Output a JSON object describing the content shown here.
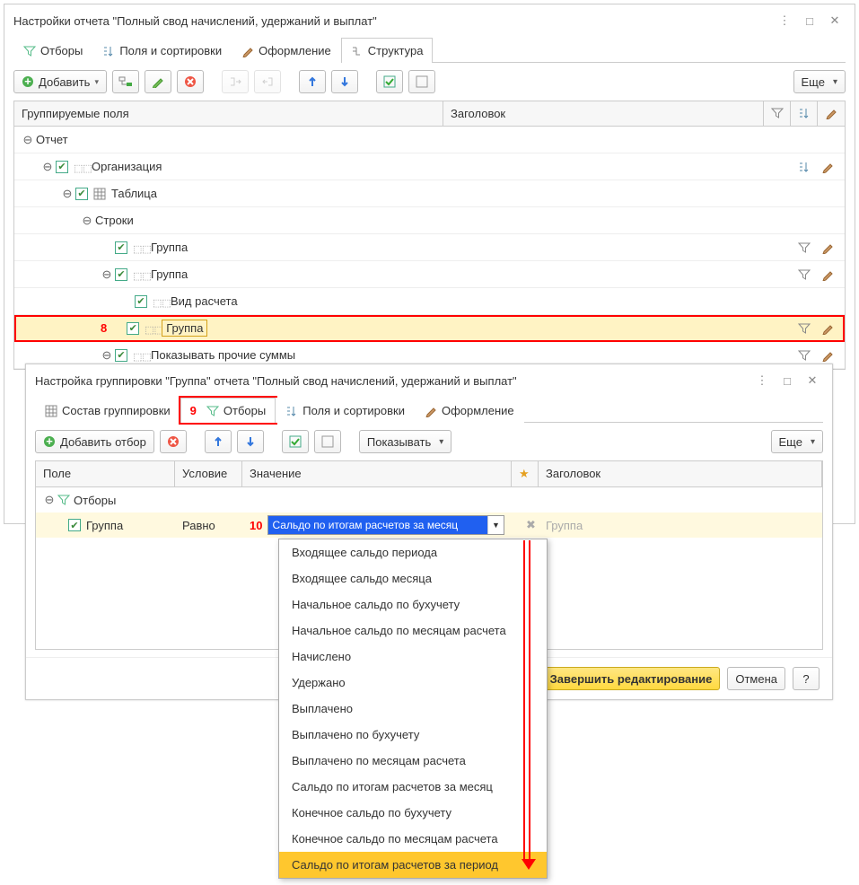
{
  "main": {
    "title": "Настройки отчета \"Полный свод начислений, удержаний и выплат\"",
    "tabs": [
      "Отборы",
      "Поля и сортировки",
      "Оформление",
      "Структура"
    ],
    "active_tab": 3,
    "toolbar": {
      "add": "Добавить",
      "more": "Еще"
    },
    "columns": {
      "group_fields": "Группируемые поля",
      "header": "Заголовок"
    },
    "annotation8": "8",
    "tree": [
      {
        "indent": 0,
        "exp": true,
        "check": false,
        "icon": "",
        "label": "Отчет"
      },
      {
        "indent": 1,
        "exp": true,
        "check": true,
        "icon": "link",
        "label": "Организация"
      },
      {
        "indent": 2,
        "exp": true,
        "check": true,
        "icon": "table",
        "label": "Таблица"
      },
      {
        "indent": 3,
        "exp": true,
        "check": false,
        "icon": "",
        "label": "Строки"
      },
      {
        "indent": 4,
        "exp": false,
        "check": true,
        "icon": "link",
        "label": "Группа"
      },
      {
        "indent": 4,
        "exp": true,
        "check": true,
        "icon": "link",
        "label": "Группа"
      },
      {
        "indent": 5,
        "exp": false,
        "check": true,
        "icon": "link",
        "label": "Вид расчета"
      },
      {
        "indent": 4,
        "exp": false,
        "check": true,
        "icon": "link",
        "label": "Группа",
        "boxed": true
      },
      {
        "indent": 4,
        "exp": true,
        "check": true,
        "icon": "link",
        "label": "Показывать прочие суммы"
      }
    ]
  },
  "sub": {
    "title": "Настройка группировки \"Группа\" отчета \"Полный свод начислений, удержаний и выплат\"",
    "tabs": [
      "Состав группировки",
      "Отборы",
      "Поля и сортировки",
      "Оформление"
    ],
    "active_tab": 1,
    "annotation9": "9",
    "toolbar": {
      "add": "Добавить отбор",
      "show": "Показывать",
      "more": "Еще"
    },
    "cols": {
      "field": "Поле",
      "cond": "Условие",
      "value": "Значение",
      "star": "★",
      "header": "Заголовок"
    },
    "root": "Отборы",
    "annotation10": "10",
    "row": {
      "field": "Группа",
      "cond": "Равно",
      "value": "Сальдо по итогам расчетов за месяц",
      "header_hint": "Группа"
    },
    "dropdown": [
      "Входящее сальдо периода",
      "Входящее сальдо месяца",
      "Начальное сальдо по бухучету",
      "Начальное сальдо по месяцам расчета",
      "Начислено",
      "Удержано",
      "Выплачено",
      "Выплачено по бухучету",
      "Выплачено по месяцам расчета",
      "Сальдо по итогам расчетов за месяц",
      "Конечное сальдо по бухучету",
      "Конечное сальдо по месяцам расчета",
      "Сальдо по итогам расчетов за период"
    ],
    "footer": {
      "done": "Завершить редактирование",
      "cancel": "Отмена",
      "help": "?"
    }
  }
}
